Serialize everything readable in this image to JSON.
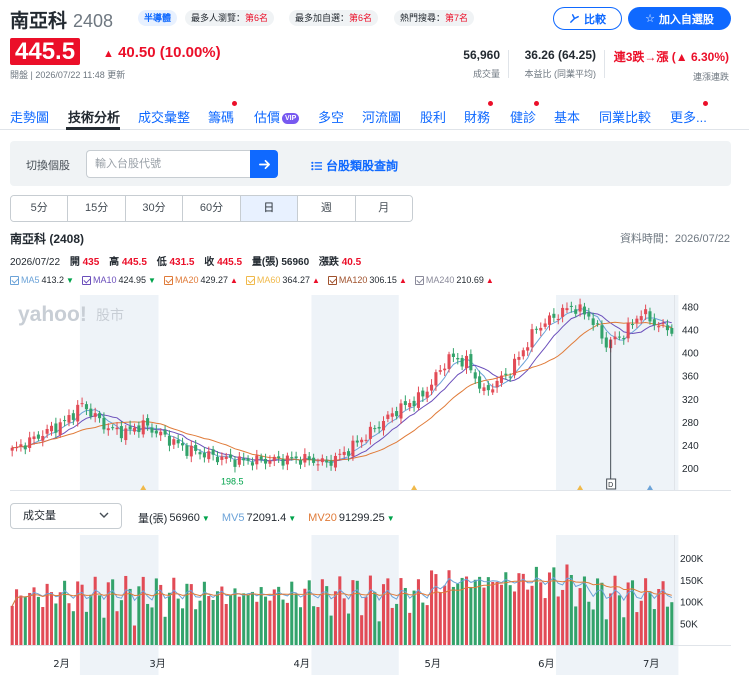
{
  "header": {
    "name": "南亞科",
    "code": "2408",
    "industry": "半導體",
    "ranks": [
      {
        "label": "最多人瀏覽：",
        "value": "第6名"
      },
      {
        "label": "最多加自選：",
        "value": "第6名"
      },
      {
        "label": "熱門搜尋：",
        "value": "第7名"
      }
    ],
    "compare_label": "比較",
    "watch_label": "加入自選股",
    "price": "445.5",
    "change": "40.50 (10.00%)",
    "status": "開盤 | 2026/07/22 11:48 更新",
    "stats": [
      {
        "value": "56,960",
        "label": "成交量"
      },
      {
        "value": "36.26 (64.25)",
        "label": "本益比 (同業平均)"
      },
      {
        "value": "連3跌→漲 (▲ 6.30%)",
        "label": "連漲連跌"
      }
    ]
  },
  "tabs": [
    "走勢圖",
    "技術分析",
    "成交彙整",
    "籌碼",
    "估價",
    "多空",
    "河流圖",
    "股利",
    "財務",
    "健診",
    "基本",
    "同業比較",
    "更多..."
  ],
  "vip_label": "VIP",
  "search": {
    "label": "切換個股",
    "placeholder": "輸入台股代號",
    "category_link": "台股類股查詢"
  },
  "periods": [
    "5分",
    "15分",
    "30分",
    "60分",
    "日",
    "週",
    "月"
  ],
  "chart_header": {
    "title": "南亞科 (2408)",
    "data_time": "資料時間：2026/07/22"
  },
  "ohlc": {
    "date": "2026/07/22",
    "open_label": "開",
    "open": "435",
    "high_label": "高",
    "high": "445.5",
    "low_label": "低",
    "low": "431.5",
    "close_label": "收",
    "close": "445.5",
    "vol_label": "量(張)",
    "vol": "56960",
    "chg_label": "漲跌",
    "chg": "40.5"
  },
  "ma_legend": [
    {
      "name": "MA5",
      "value": "413.2",
      "dir": "down",
      "color": "#6ca3d8"
    },
    {
      "name": "MA10",
      "value": "424.95",
      "dir": "down",
      "color": "#6b4fbb"
    },
    {
      "name": "MA20",
      "value": "429.27",
      "dir": "up",
      "color": "#e07b39"
    },
    {
      "name": "MA60",
      "value": "364.27",
      "dir": "up",
      "color": "#f0b94a"
    },
    {
      "name": "MA120",
      "value": "306.15",
      "dir": "up",
      "color": "#a0522d"
    },
    {
      "name": "MA240",
      "value": "210.69",
      "dir": "up",
      "color": "#8a8a9a"
    }
  ],
  "watermark": {
    "brand": "yahoo!",
    "sub": "股市"
  },
  "volume": {
    "select_label": "成交量",
    "legend": [
      {
        "name": "量(張)",
        "value": "56960",
        "dir": "down",
        "color": "#232a31"
      },
      {
        "name": "MV5",
        "value": "72091.4",
        "dir": "down",
        "color": "#6ca3d8"
      },
      {
        "name": "MV20",
        "value": "91299.25",
        "dir": "down",
        "color": "#e07b39"
      }
    ]
  },
  "chart_data": {
    "type": "candlestick",
    "price_ticks": [
      480,
      440,
      400,
      360,
      320,
      280,
      240,
      200
    ],
    "ylim": [
      160,
      500
    ],
    "volume_ticks": [
      "200K",
      "150K",
      "100K",
      "50K"
    ],
    "volume_lim": [
      0,
      230000
    ],
    "month_labels": [
      "2月",
      "3月",
      "4月",
      "5月",
      "6月",
      "7月"
    ],
    "annotations": {
      "high": "505",
      "low": "198.5",
      "marker": "D"
    },
    "up_color": "#e24b56",
    "down_color": "#33a36b"
  }
}
